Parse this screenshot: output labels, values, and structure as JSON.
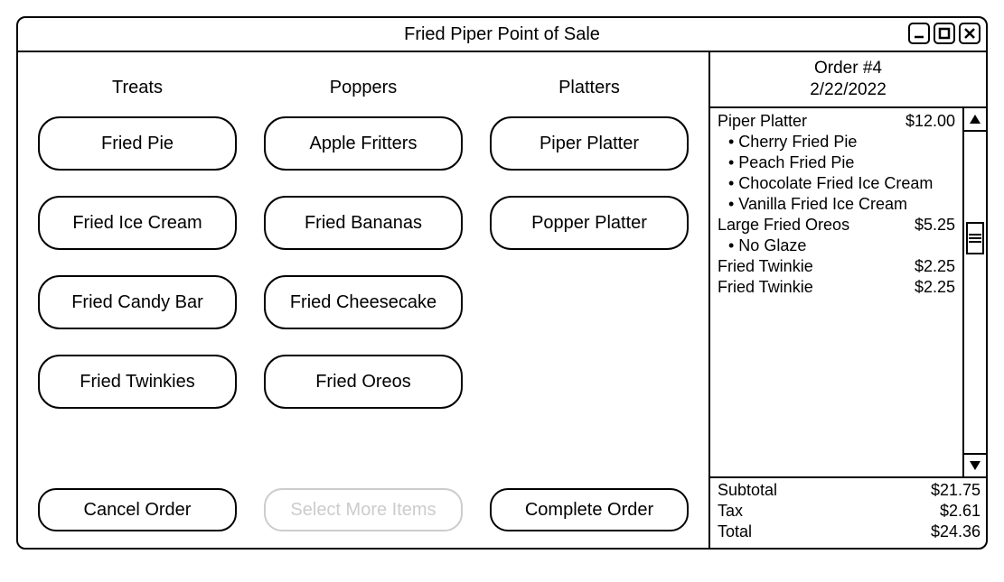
{
  "window": {
    "title": "Fried Piper Point of Sale"
  },
  "menu": {
    "columns": [
      {
        "title": "Treats",
        "items": [
          "Fried Pie",
          "Fried Ice Cream",
          "Fried Candy Bar",
          "Fried Twinkies"
        ]
      },
      {
        "title": "Poppers",
        "items": [
          "Apple Fritters",
          "Fried Bananas",
          "Fried Cheesecake",
          "Fried Oreos"
        ]
      },
      {
        "title": "Platters",
        "items": [
          "Piper Platter",
          "Popper Platter"
        ]
      }
    ]
  },
  "actions": {
    "cancel": "Cancel Order",
    "select_more": "Select More Items",
    "complete": "Complete Order"
  },
  "order": {
    "header_title": "Order #4",
    "header_date": "2/22/2022",
    "items": [
      {
        "name": "Piper Platter",
        "price": "$12.00",
        "subs": [
          "Cherry Fried Pie",
          "Peach Fried Pie",
          "Chocolate Fried Ice Cream",
          "Vanilla Fried Ice Cream"
        ]
      },
      {
        "name": "Large Fried Oreos",
        "price": "$5.25",
        "subs": [
          "No Glaze"
        ]
      },
      {
        "name": "Fried Twinkie",
        "price": "$2.25",
        "subs": []
      },
      {
        "name": "Fried Twinkie",
        "price": "$2.25",
        "subs": []
      }
    ],
    "totals": {
      "subtotal_label": "Subtotal",
      "subtotal_value": "$21.75",
      "tax_label": "Tax",
      "tax_value": "$2.61",
      "total_label": "Total",
      "total_value": "$24.36"
    }
  }
}
